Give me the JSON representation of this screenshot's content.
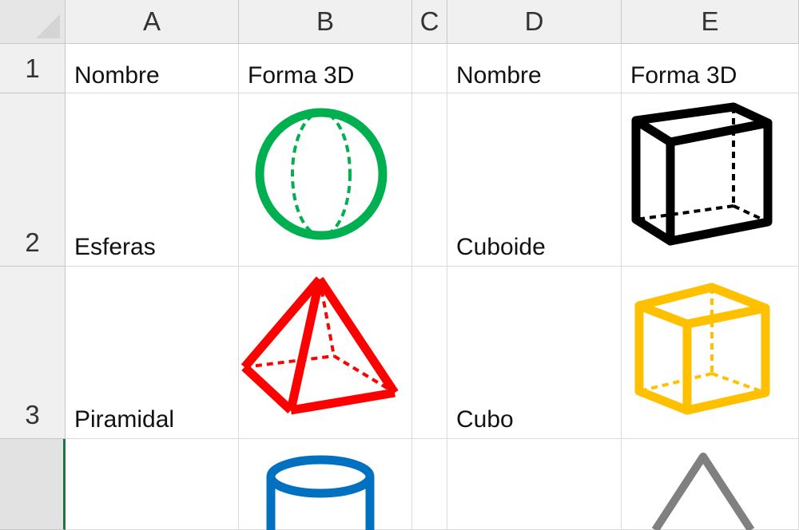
{
  "columns": [
    "A",
    "B",
    "C",
    "D",
    "E"
  ],
  "rows": [
    "1",
    "2",
    "3",
    ""
  ],
  "cells": {
    "A1": "Nombre",
    "B1": "Forma 3D",
    "D1": "Nombre",
    "E1": "Forma 3D",
    "A2": "Esferas",
    "D2": "Cuboide",
    "A3": "Piramidal",
    "D3": "Cubo"
  },
  "shapes": [
    {
      "cell": "B2",
      "icon": "sphere-icon",
      "color": "#00b050"
    },
    {
      "cell": "E2",
      "icon": "cuboid-icon",
      "color": "#000000"
    },
    {
      "cell": "B3",
      "icon": "pyramid-icon",
      "color": "#ff0000"
    },
    {
      "cell": "E3",
      "icon": "cube-icon",
      "color": "#ffc000"
    },
    {
      "cell": "B4",
      "icon": "cylinder-icon",
      "color": "#0070c0"
    },
    {
      "cell": "E4",
      "icon": "cone-icon",
      "color": "#808080"
    }
  ],
  "theme": {
    "selection_color": "#217346",
    "header_bg": "#f0f0f0",
    "grid_color": "#dadada"
  }
}
